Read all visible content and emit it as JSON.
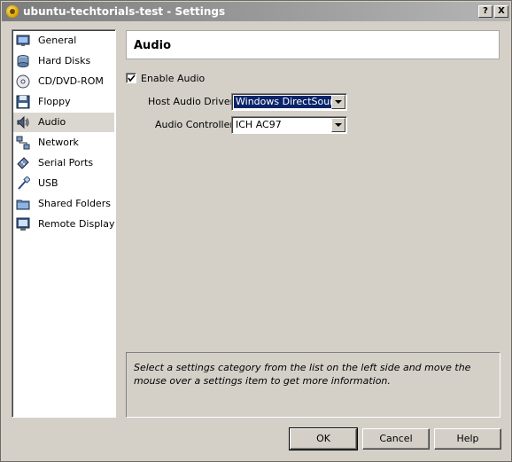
{
  "window": {
    "title": "ubuntu-techtorials-test - Settings",
    "help_button": "?",
    "close_button": "X"
  },
  "sidebar": {
    "items": [
      {
        "label": "General",
        "icon": "monitor-icon"
      },
      {
        "label": "Hard Disks",
        "icon": "hard-disk-icon"
      },
      {
        "label": "CD/DVD-ROM",
        "icon": "optical-disc-icon"
      },
      {
        "label": "Floppy",
        "icon": "floppy-icon"
      },
      {
        "label": "Audio",
        "icon": "speaker-icon",
        "selected": true
      },
      {
        "label": "Network",
        "icon": "network-icon"
      },
      {
        "label": "Serial Ports",
        "icon": "serial-port-icon"
      },
      {
        "label": "USB",
        "icon": "usb-icon"
      },
      {
        "label": "Shared Folders",
        "icon": "shared-folder-icon"
      },
      {
        "label": "Remote Display",
        "icon": "remote-display-icon"
      }
    ]
  },
  "page": {
    "title": "Audio",
    "enable_audio": {
      "label": "Enable Audio",
      "checked": true
    },
    "host_driver": {
      "label": "Host Audio Driver:",
      "value": "Windows DirectSound"
    },
    "controller": {
      "label": "Audio Controller:",
      "value": "ICH AC97"
    }
  },
  "info": {
    "text": "Select a settings category from the list on the left side and move the mouse over a settings item to get more information."
  },
  "buttons": {
    "ok": "OK",
    "cancel": "Cancel",
    "help": "Help"
  },
  "colors": {
    "selection": "#0a246a",
    "face": "#d4d0c8"
  }
}
